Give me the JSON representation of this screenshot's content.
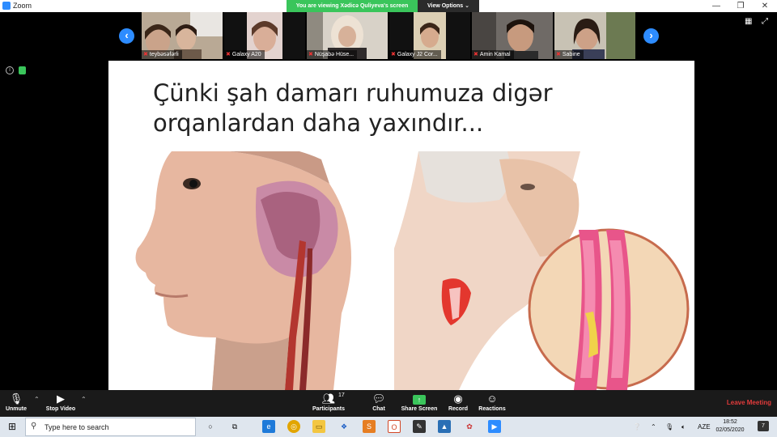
{
  "window": {
    "title": "Zoom",
    "banner_text": "You are viewing Xədicə Quliyeva's screen",
    "view_options_label": "View Options",
    "minimize_glyph": "—",
    "restore_glyph": "❐",
    "close_glyph": "✕"
  },
  "participants": [
    {
      "name": "teybəsəfərli",
      "muted": true
    },
    {
      "name": "Galaxy A20",
      "muted": true
    },
    {
      "name": "Nüşabə Hüse...",
      "muted": true
    },
    {
      "name": "Galaxy J2 Cor...",
      "muted": true
    },
    {
      "name": "Amin Kamal",
      "muted": true
    },
    {
      "name": "Sabine",
      "muted": true
    }
  ],
  "nav": {
    "prev_glyph": "‹",
    "next_glyph": "›"
  },
  "slide": {
    "title": "Çünki şah damarı ruhumuza digər orqanlardan daha yaxındır..."
  },
  "controls": {
    "unmute": "Unmute",
    "stop_video": "Stop Video",
    "participants": "Participants",
    "participants_count": "17",
    "chat": "Chat",
    "share_screen": "Share Screen",
    "record": "Record",
    "reactions": "Reactions",
    "leave": "Leave Meeting"
  },
  "taskbar": {
    "search_placeholder": "Type here to search",
    "language": "AZE",
    "time": "18:52",
    "date": "02/05/2020",
    "notifications": "7"
  },
  "colors": {
    "zoom_blue": "#2d8cff",
    "banner_green": "#3ac55b",
    "leave_red": "#e23b3b",
    "control_bar": "#1a1a1a",
    "taskbar": "#dfe6ee"
  }
}
